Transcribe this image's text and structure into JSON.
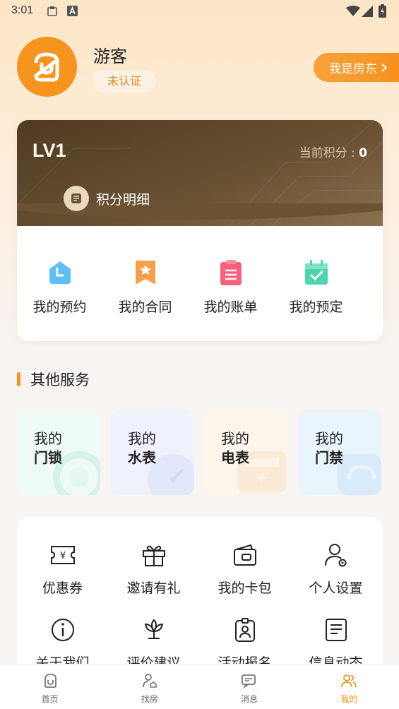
{
  "status_bar": {
    "time": "3:01"
  },
  "profile": {
    "username": "游客",
    "auth_status": "未认证",
    "landlord_button": "我是房东"
  },
  "level_card": {
    "level": "LV1",
    "points_label": "当前积分 : ",
    "points_value": "0",
    "points_detail": "积分明细",
    "quick_actions": [
      {
        "label": "我的预约",
        "icon": "home-icon"
      },
      {
        "label": "我的合同",
        "icon": "bookmark-star-icon"
      },
      {
        "label": "我的账单",
        "icon": "bill-icon"
      },
      {
        "label": "我的预定",
        "icon": "calendar-check-icon"
      }
    ]
  },
  "other_services": {
    "title": "其他服务",
    "tiles": [
      {
        "line1": "我的",
        "line2": "门锁",
        "color": "#eaf9f3"
      },
      {
        "line1": "我的",
        "line2": "水表",
        "color": "#eef0fd"
      },
      {
        "line1": "我的",
        "line2": "电表",
        "color": "#fdf3e8"
      },
      {
        "line1": "我的",
        "line2": "门禁",
        "color": "#e8f3fd"
      }
    ]
  },
  "grid_items": [
    {
      "label": "优惠券",
      "icon": "coupon-icon"
    },
    {
      "label": "邀请有礼",
      "icon": "gift-icon"
    },
    {
      "label": "我的卡包",
      "icon": "wallet-icon"
    },
    {
      "label": "个人设置",
      "icon": "user-settings-icon"
    },
    {
      "label": "关于我们",
      "icon": "info-icon"
    },
    {
      "label": "评价建议",
      "icon": "flower-icon"
    },
    {
      "label": "活动报名",
      "icon": "badge-icon"
    },
    {
      "label": "信息动态",
      "icon": "news-icon"
    }
  ],
  "bottom_nav": [
    {
      "label": "首页",
      "active": false
    },
    {
      "label": "找房",
      "active": false
    },
    {
      "label": "消息",
      "active": false
    },
    {
      "label": "我的",
      "active": true
    }
  ],
  "colors": {
    "accent": "#f7941d",
    "card_dark": "#5a4428"
  }
}
